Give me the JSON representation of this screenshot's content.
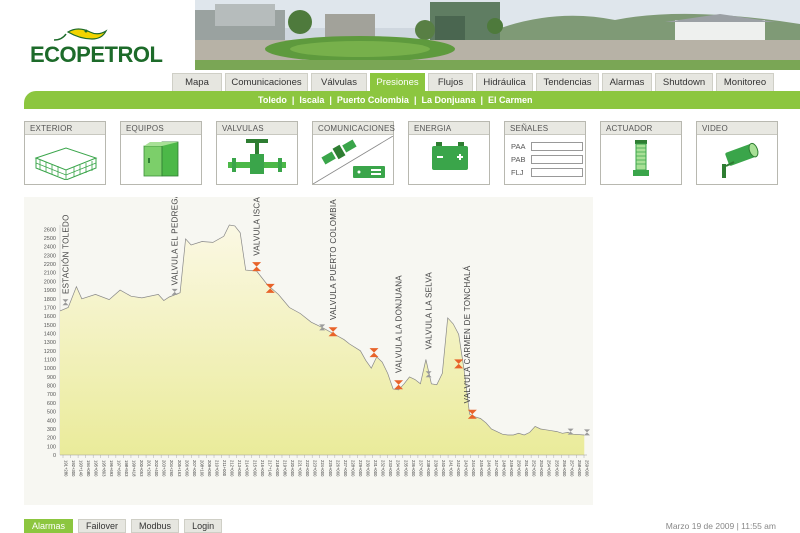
{
  "brand": {
    "logo_text": "ECOPETROL",
    "accent": "#8cc63f",
    "logo_green": "#1d6b2a",
    "logo_yellow": "#f2d400"
  },
  "tabs": [
    {
      "label": "Mapa",
      "active": false
    },
    {
      "label": "Comunicaciones",
      "active": false
    },
    {
      "label": "Válvulas",
      "active": false
    },
    {
      "label": "Presiones",
      "active": true
    },
    {
      "label": "Flujos",
      "active": false
    },
    {
      "label": "Hidráulica",
      "active": false
    },
    {
      "label": "Tendencias",
      "active": false
    },
    {
      "label": "Alarmas",
      "active": false
    },
    {
      "label": "Shutdown",
      "active": false
    },
    {
      "label": "Monitoreo",
      "active": false
    }
  ],
  "subnav": [
    "Toledo",
    "Iscala",
    "Puerto Colombia",
    "La Donjuana",
    "El Carmen"
  ],
  "categories": {
    "exterior": "EXTERIOR",
    "equipos": "EQUIPOS",
    "valvulas": "VALVULAS",
    "comunicaciones": "COMUNICACIONES",
    "energia": "ENERGIA",
    "senales": "SEÑALES",
    "actuador": "ACTUADOR",
    "video": "VIDEO"
  },
  "signals": [
    {
      "label": "PAA",
      "value": ""
    },
    {
      "label": "PAB",
      "value": ""
    },
    {
      "label": "FLJ",
      "value": ""
    }
  ],
  "chart_data": {
    "type": "area",
    "yticks": [
      0,
      100,
      200,
      300,
      400,
      500,
      600,
      700,
      800,
      900,
      1000,
      1100,
      1200,
      1300,
      1400,
      1500,
      1600,
      1700,
      1800,
      1900,
      2000,
      2100,
      2200,
      2300,
      2400,
      2500,
      2600
    ],
    "ylim": [
      0,
      2650
    ],
    "xticks": [
      "191+280",
      "192+300",
      "193+140",
      "194+080",
      "195+000",
      "195+803",
      "196+693",
      "197+600",
      "198+503",
      "199+418",
      "200+053",
      "201+260",
      "202+400",
      "203+300",
      "204+260",
      "205+163",
      "206+060",
      "207+000",
      "208+100",
      "209+060",
      "210+000",
      "211+000",
      "212+000",
      "213+050",
      "214+000",
      "215+000",
      "216+000",
      "217+140",
      "218+000",
      "219+080",
      "220+000",
      "221+000",
      "222+000",
      "223+000",
      "224+000",
      "225+000",
      "226+060",
      "227+000",
      "228+000",
      "229+000",
      "230+000",
      "231+000",
      "232+000",
      "233+000",
      "234+000",
      "235+000",
      "236+000",
      "237+000",
      "238+000",
      "239+000",
      "240+000",
      "241+000",
      "242+000",
      "243+000",
      "244+000",
      "245+000",
      "246+000",
      "247+000",
      "248+000",
      "249+000",
      "250+000",
      "251+000",
      "252+000",
      "253+000",
      "254+000",
      "255+000",
      "256+000",
      "257+000",
      "258+000",
      "259+000"
    ],
    "profile": [
      [
        0,
        1660
      ],
      [
        1.5,
        1700
      ],
      [
        3,
        1940
      ],
      [
        4,
        1800
      ],
      [
        6.5,
        1850
      ],
      [
        9,
        1790
      ],
      [
        11,
        1900
      ],
      [
        13,
        1830
      ],
      [
        15,
        1810
      ],
      [
        18,
        1850
      ],
      [
        19,
        1780
      ],
      [
        20,
        1820
      ],
      [
        22,
        1870
      ],
      [
        23,
        2490
      ],
      [
        24,
        2420
      ],
      [
        26,
        2460
      ],
      [
        28,
        2450
      ],
      [
        30,
        2520
      ],
      [
        31,
        2650
      ],
      [
        32,
        2640
      ],
      [
        33,
        2560
      ],
      [
        34,
        2130
      ],
      [
        36,
        2120
      ],
      [
        38,
        1960
      ],
      [
        40,
        1850
      ],
      [
        42,
        1700
      ],
      [
        44,
        1630
      ],
      [
        46,
        1530
      ],
      [
        48,
        1470
      ],
      [
        50,
        1400
      ],
      [
        52,
        1330
      ],
      [
        53,
        1280
      ],
      [
        55,
        1200
      ],
      [
        56,
        1090
      ],
      [
        57,
        1000
      ],
      [
        58,
        1130
      ],
      [
        59,
        1070
      ],
      [
        60,
        940
      ],
      [
        61,
        760
      ],
      [
        62,
        750
      ],
      [
        63,
        820
      ],
      [
        64,
        900
      ],
      [
        65,
        870
      ],
      [
        66,
        820
      ],
      [
        67,
        1100
      ],
      [
        68,
        820
      ],
      [
        69,
        810
      ],
      [
        70,
        940
      ],
      [
        71,
        1580
      ],
      [
        72,
        1510
      ],
      [
        73,
        1390
      ],
      [
        74,
        980
      ],
      [
        75,
        470
      ],
      [
        76,
        440
      ],
      [
        77,
        420
      ],
      [
        78,
        370
      ],
      [
        79,
        300
      ],
      [
        80,
        270
      ],
      [
        81,
        240
      ],
      [
        82,
        230
      ],
      [
        83,
        230
      ],
      [
        84,
        250
      ],
      [
        85,
        230
      ],
      [
        86,
        260
      ],
      [
        87,
        330
      ],
      [
        88,
        300
      ],
      [
        89,
        290
      ],
      [
        90,
        280
      ],
      [
        91,
        270
      ],
      [
        92,
        250
      ],
      [
        93,
        260
      ],
      [
        94,
        240
      ],
      [
        96,
        230
      ]
    ],
    "labels": [
      {
        "text": "ESTACIÓN TOLEDO",
        "x": 1.0,
        "y": 1740
      },
      {
        "text": "VALVULA EL PEDREGAL",
        "x": 21.0,
        "y": 1840
      },
      {
        "text": "VALVULA ISCALA",
        "x": 36.0,
        "y": 2180
      },
      {
        "text": "VALVULA PUERTO COLOMBIA",
        "x": 50.0,
        "y": 1440
      },
      {
        "text": "VALVULA LA DONJUANA",
        "x": 62.0,
        "y": 830
      },
      {
        "text": "VALVULA LA SELVA",
        "x": 67.5,
        "y": 1100
      },
      {
        "text": "VALVULA CARMEN DE TONCHALÁ",
        "x": 74.5,
        "y": 480
      }
    ],
    "markers": [
      {
        "x": 1.0,
        "y": 1760,
        "kind": "gray"
      },
      {
        "x": 21.0,
        "y": 1880,
        "kind": "gray"
      },
      {
        "x": 36.0,
        "y": 2170,
        "kind": "orange"
      },
      {
        "x": 38.5,
        "y": 1920,
        "kind": "orange"
      },
      {
        "x": 48.0,
        "y": 1470,
        "kind": "gray"
      },
      {
        "x": 50.0,
        "y": 1420,
        "kind": "orange"
      },
      {
        "x": 57.5,
        "y": 1180,
        "kind": "orange"
      },
      {
        "x": 62.0,
        "y": 810,
        "kind": "orange"
      },
      {
        "x": 67.5,
        "y": 930,
        "kind": "gray"
      },
      {
        "x": 73.0,
        "y": 1050,
        "kind": "orange"
      },
      {
        "x": 75.5,
        "y": 470,
        "kind": "orange"
      },
      {
        "x": 93.5,
        "y": 270,
        "kind": "gray"
      },
      {
        "x": 96.5,
        "y": 260,
        "kind": "gray"
      }
    ]
  },
  "footer": {
    "buttons": [
      {
        "label": "Alarmas",
        "active": true
      },
      {
        "label": "Failover",
        "active": false
      },
      {
        "label": "Modbus",
        "active": false
      },
      {
        "label": "Login",
        "active": false
      }
    ],
    "datetime": "Marzo 19 de 2009  |  11:55 am"
  }
}
